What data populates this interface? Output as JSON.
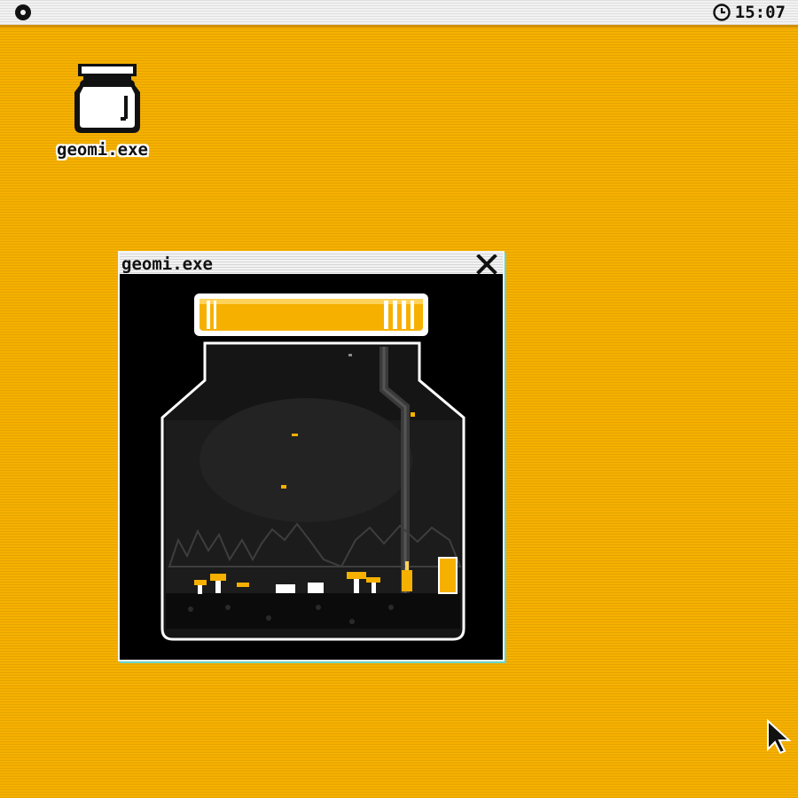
{
  "menubar": {
    "system_menu_icon": "circle-menu-icon",
    "clock_icon": "clock-icon",
    "time": "15:07"
  },
  "desktop": {
    "background_color": "#f6b000",
    "icons": [
      {
        "label": "geomi.exe",
        "icon": "jar-icon"
      }
    ]
  },
  "window": {
    "title": "geomi.exe",
    "close_icon": "close-icon",
    "content": "jar-terrarium-scene"
  },
  "colors": {
    "accent": "#f6b000",
    "window_bg": "#000000",
    "titlebar": "#f3f3f3"
  },
  "cursor": "arrow-cursor-icon"
}
